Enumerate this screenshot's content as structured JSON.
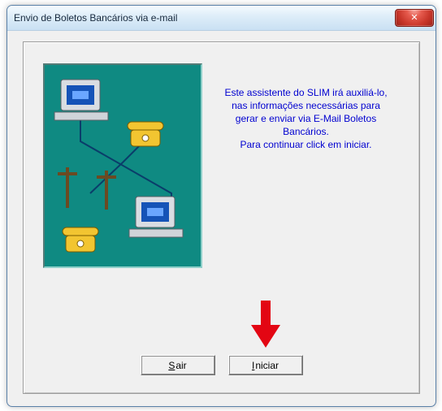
{
  "window": {
    "title": "Envio de Boletos Bancários via e-mail",
    "close_icon": "close-icon"
  },
  "wizard": {
    "line1": "Este assistente do SLIM irá auxiliá-lo,",
    "line2": "nas informações necessárias para",
    "line3": "gerar e enviar via E-Mail Boletos",
    "line4": "Bancários.",
    "line5": "Para continuar click em iniciar."
  },
  "buttons": {
    "exit": {
      "mnemonic": "S",
      "rest": "air"
    },
    "start": {
      "mnemonic": "I",
      "rest": "niciar"
    }
  },
  "illustration": {
    "name": "network-computers-illustration"
  },
  "annotation": {
    "name": "red-down-arrow"
  }
}
